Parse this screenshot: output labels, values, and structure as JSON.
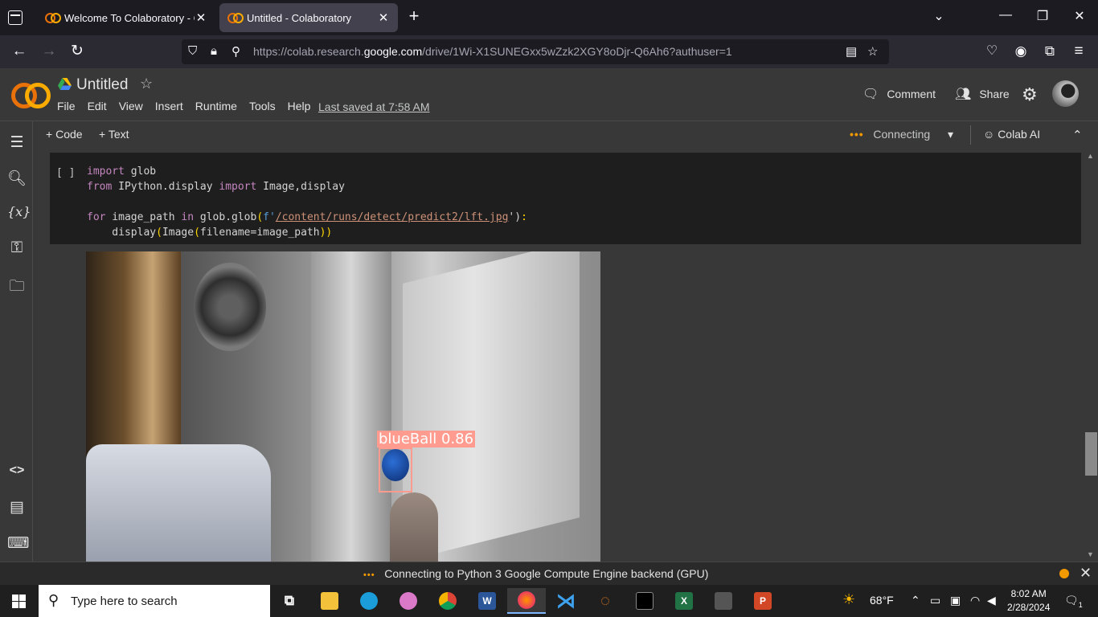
{
  "browser": {
    "tabs": [
      {
        "label": "Welcome To Colaboratory - Col",
        "active": false
      },
      {
        "label": "Untitled - Colaboratory",
        "active": true
      }
    ],
    "url_prefix": "https://colab.research.",
    "url_domain": "google.com",
    "url_path": "/drive/1Wi-X1SUNEGxx5wZzk2XGY8oDjr-Q6Ah6?authuser=1"
  },
  "colab": {
    "title": "Untitled",
    "menu": [
      "File",
      "Edit",
      "View",
      "Insert",
      "Runtime",
      "Tools",
      "Help"
    ],
    "last_saved": "Last saved at 7:58 AM",
    "comment_label": "Comment",
    "share_label": "Share"
  },
  "toolbar": {
    "add_code": "Code",
    "add_text": "Text",
    "runtime_status": "Connecting",
    "colab_ai": "Colab AI"
  },
  "cell": {
    "run_indicator": "[ ]",
    "code_lines": {
      "l1_kw": "import",
      "l1_rest": " glob",
      "l2_kw1": "from",
      "l2_mid": " IPython.display ",
      "l2_kw2": "import",
      "l2_rest": " Image,display",
      "l4_kw1": "for",
      "l4_a": " image_path ",
      "l4_kw2": "in",
      "l4_b": " glob.glob",
      "l4_f": "f'",
      "l4_str": "/content/runs/detect/predict2/lft.jpg",
      "l4_end": "')",
      "l5_a": "    display",
      "l5_b": "Image",
      "l5_c": "filename=image_path"
    }
  },
  "output": {
    "detection_label": "blueBall 0.86"
  },
  "statusbar": {
    "text": "Connecting to Python 3 Google Compute Engine backend (GPU)"
  },
  "taskbar": {
    "search_placeholder": "Type here to search",
    "weather": "68°F",
    "time": "8:02 AM",
    "date": "2/28/2024",
    "notification_count": "1"
  }
}
